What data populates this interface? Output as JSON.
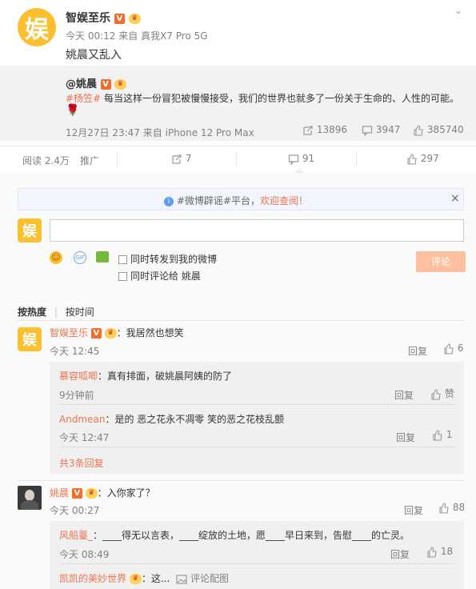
{
  "post": {
    "author": "智娱至乐",
    "time": "今天 00:12",
    "source_prefix": "来自",
    "source": "真我X7 Pro 5G",
    "text": "姚晨又乱入",
    "avatar_char": "娱"
  },
  "repost": {
    "author": "@姚晨",
    "tag": "#杨笠#",
    "text": " 每当这样一份冒犯被慢慢接受，我们的世界也就多了一份关于生命的、人性的可能。",
    "emoji": "🌹",
    "time": "12月27日 23:47",
    "source_prefix": "来自",
    "source": "iPhone 12 Pro Max",
    "reposts": "13896",
    "comments": "3947",
    "likes": "385740"
  },
  "stats": {
    "reads": "阅读 2.4万",
    "promote": "推广",
    "reposts": "7",
    "comments": "91",
    "likes": "297"
  },
  "notice": {
    "text_tag": "#微博辟谣#平台，",
    "text_action": "欢迎查阅！",
    "close": "×"
  },
  "composer": {
    "avatar_char": "娱",
    "opt1": "同时转发到我的微博",
    "opt2": "同时评论给 姚晨",
    "submit": "评论"
  },
  "sort": {
    "hot": "按热度",
    "time": "按时间"
  },
  "comments": [
    {
      "author": "智娱至乐",
      "text": "：我居然也想笑",
      "time": "今天 12:45",
      "reply": "回复",
      "likes": "6",
      "avatar_char": "娱",
      "replies": [
        {
          "author": "慕容呱唧",
          "text": "：真有排面，破姚晨阿姨的防了",
          "time": "9分钟前",
          "reply": "回复",
          "likes": "赞"
        },
        {
          "author": "Andmean",
          "text": "：是的 恶之花永不凋零 笑的恶之花枝乱颤",
          "time": "今天 12:47",
          "reply": "回复",
          "likes": "1"
        }
      ],
      "more": "共3条回复"
    },
    {
      "author": "姚晨",
      "text": "：入你家了？",
      "time": "今天 00:27",
      "reply": "回复",
      "likes": "88",
      "replies": [
        {
          "author": "风船薹_",
          "text": "：____得无以言表，____绽放的土地，愿____早日来到，告慰____的亡灵。",
          "time": "今天 08:49",
          "reply": "回复",
          "likes": "18"
        },
        {
          "author": "凯凯的美妙世界",
          "text": "：这...",
          "extra": "评论配图"
        }
      ]
    }
  ]
}
